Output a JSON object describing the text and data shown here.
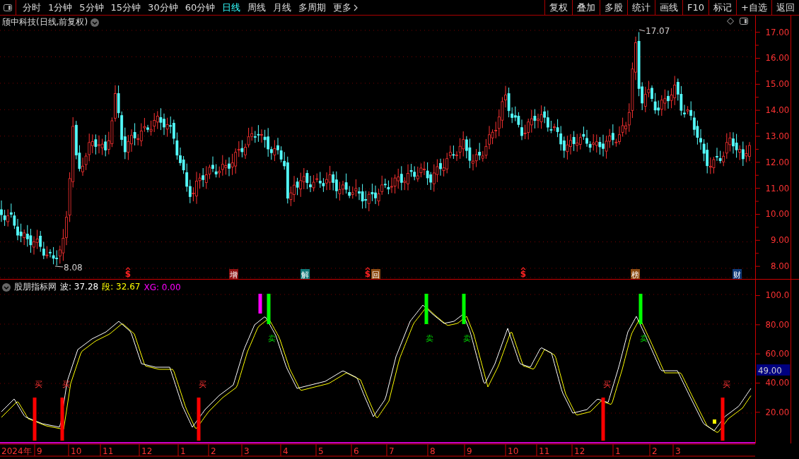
{
  "toolbar": {
    "periods": [
      {
        "label": "分时",
        "selected": false
      },
      {
        "label": "1分钟",
        "selected": false
      },
      {
        "label": "5分钟",
        "selected": false
      },
      {
        "label": "15分钟",
        "selected": false
      },
      {
        "label": "30分钟",
        "selected": false
      },
      {
        "label": "60分钟",
        "selected": false
      },
      {
        "label": "日线",
        "selected": true
      },
      {
        "label": "周线",
        "selected": false
      },
      {
        "label": "月线",
        "selected": false
      },
      {
        "label": "多周期",
        "selected": false
      },
      {
        "label": "更多",
        "selected": false
      }
    ],
    "buttons": [
      "复权",
      "叠加",
      "多股",
      "统计",
      "画线",
      "F10",
      "标记",
      "+自选",
      "返回"
    ]
  },
  "main_chart": {
    "title": "颀中科技(日线,前复权)",
    "high_label": "17.07",
    "low_label": "8.08",
    "price_ticks": [
      "17.00",
      "16.00",
      "15.00",
      "14.00",
      "13.00",
      "12.00",
      "11.00",
      "10.00",
      "9.00",
      "8.00"
    ],
    "events": [
      {
        "kind": "dollar",
        "label": "$"
      },
      {
        "kind": "tag",
        "label": "增",
        "color": "#8b1010"
      },
      {
        "kind": "tag",
        "label": "解",
        "color": "#107878"
      },
      {
        "kind": "dollar",
        "label": "$"
      },
      {
        "kind": "tag",
        "label": "回",
        "color": "#8b4a10"
      },
      {
        "kind": "dollar",
        "label": "$"
      },
      {
        "kind": "tag",
        "label": "榜",
        "color": "#8b4a10"
      },
      {
        "kind": "tag",
        "label": "财",
        "color": "#103a78"
      }
    ]
  },
  "indicator": {
    "name": "股朋指标网",
    "readings": [
      {
        "label": "波: 37.28",
        "color": "#ffffff"
      },
      {
        "label": "段: 32.67",
        "color": "#ffff00"
      },
      {
        "label": "XG: 0.00",
        "color": "#ff00ff"
      }
    ],
    "ticks": [
      "100.0",
      "80.00",
      "60.00",
      "40.00",
      "20.00"
    ],
    "current": "49.00",
    "signals": [
      {
        "kind": "buy",
        "label": "买"
      },
      {
        "kind": "buy",
        "label": "买"
      },
      {
        "kind": "buy",
        "label": "买"
      },
      {
        "kind": "xg"
      },
      {
        "kind": "sell",
        "label": "卖"
      },
      {
        "kind": "sell",
        "label": "卖"
      },
      {
        "kind": "sell",
        "label": "卖"
      },
      {
        "kind": "buy",
        "label": "买"
      },
      {
        "kind": "sell",
        "label": "卖"
      },
      {
        "kind": "buy",
        "label": "买"
      }
    ]
  },
  "date_axis": [
    "2024年",
    "9",
    "10",
    "11",
    "12",
    "1",
    "2",
    "3",
    "4",
    "5",
    "6",
    "7",
    "8",
    "9",
    "10",
    "11",
    "12",
    "1",
    "2",
    "3"
  ]
}
